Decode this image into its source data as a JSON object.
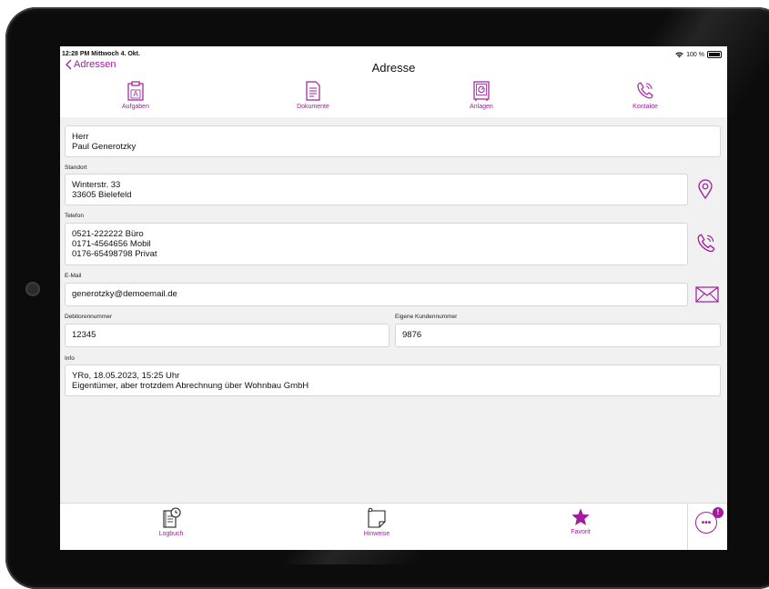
{
  "status": {
    "time": "12:28 PM  Mittwoch 4. Okt.",
    "battery": "100 %"
  },
  "nav": {
    "back_label": "Adressen",
    "title": "Adresse"
  },
  "toolbar": [
    {
      "label": "Aufgaben",
      "icon": "tasks-icon"
    },
    {
      "label": "Dokumente",
      "icon": "document-icon"
    },
    {
      "label": "Anlagen",
      "icon": "safe-icon"
    },
    {
      "label": "Kontakte",
      "icon": "phone-icon"
    }
  ],
  "contact": {
    "salutation": "Herr",
    "name": "Paul Generotzky",
    "standort_label": "Standort",
    "street": "Winterstr. 33",
    "city": "33605 Bielefeld",
    "telefon_label": "Telefon",
    "phones": [
      "0521-222222 Büro",
      "0171-4564656 Mobil",
      "0176-65498798 Privat"
    ],
    "email_label": "E-Mail",
    "email": "generotzky@demoemail.de",
    "debitor_label": "Debitorennummer",
    "debitor": "12345",
    "kunden_label": "Eigene Kundennummer",
    "kunden": "9876",
    "info_label": "Info",
    "info_lines": [
      "YRo, 18.05.2023, 15:25 Uhr",
      "Eigentümer, aber trotzdem Abrechnung über Wohnbau GmbH"
    ]
  },
  "bottombar": [
    {
      "label": "Logbuch",
      "icon": "logbook-icon"
    },
    {
      "label": "Hinweise",
      "icon": "note-icon"
    },
    {
      "label": "Favorit",
      "icon": "star-icon"
    }
  ],
  "more": {
    "badge": "!"
  },
  "colors": {
    "accent": "#a01c9c",
    "background": "#f1f1f1"
  }
}
